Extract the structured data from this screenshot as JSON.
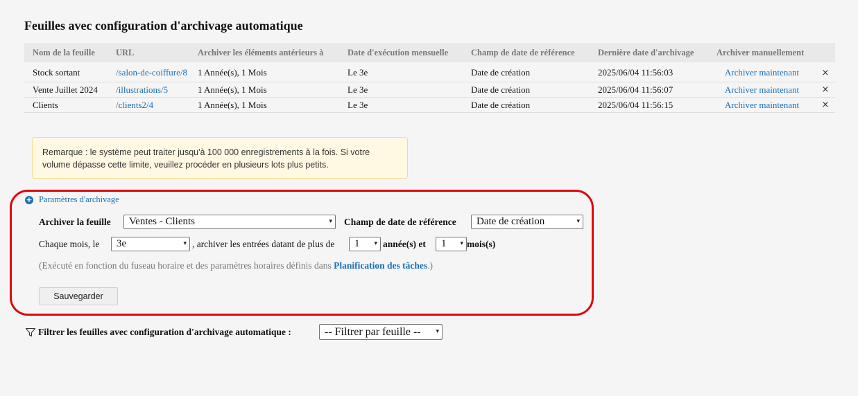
{
  "page": {
    "title": "Feuilles avec configuration d'archivage automatique"
  },
  "table": {
    "headers": [
      "Nom de la feuille",
      "URL",
      "Archiver les éléments antérieurs à",
      "Date d'exécution mensuelle",
      "Champ de date de référence",
      "Dernière date d'archivage",
      "Archiver manuellement"
    ],
    "rows": [
      {
        "name": "Stock sortant",
        "url": "/salon-de-coiffure/8",
        "archive_before": "1 Année(s), 1 Mois",
        "monthly_run": "Le 3e",
        "reference_field": "Date de création",
        "last_archive": "2025/06/04 11:56:03",
        "manual_action": "Archiver maintenant",
        "delete_icon": "×"
      },
      {
        "name": "Vente Juillet 2024",
        "url": "/illustrations/5",
        "archive_before": "1 Année(s), 1 Mois",
        "monthly_run": "Le 3e",
        "reference_field": "Date de création",
        "last_archive": "2025/06/04 11:56:07",
        "manual_action": "Archiver maintenant",
        "delete_icon": "×"
      },
      {
        "name": "Clients",
        "url": "/clients2/4",
        "archive_before": "1 Année(s), 1 Mois",
        "monthly_run": "Le 3e",
        "reference_field": "Date de création",
        "last_archive": "2025/06/04 11:56:15",
        "manual_action": "Archiver maintenant",
        "delete_icon": "×"
      }
    ]
  },
  "notice": {
    "text": "Remarque : le système peut traiter jusqu'à 100 000 enregistrements à la fois. Si votre volume dépasse cette limite, veuillez procéder en plusieurs lots plus petits."
  },
  "settings": {
    "toggle_label": "Paramètres d'archivage",
    "archive_sheet_label": "Archiver la feuille",
    "archive_sheet_value": "Ventes - Clients",
    "reference_field_label": "Champ de date de référence",
    "reference_field_value": "Date de création",
    "each_month_label": "Chaque mois, le",
    "day_value": "3e",
    "archive_entries_label": ", archiver les entrées datant de plus de",
    "years_value": "1",
    "years_label": "année(s) et",
    "months_value": "1",
    "months_label": "mois(s)",
    "hint_prefix": "(Exécuté en fonction du fuseau horaire et des paramètres horaires définis dans",
    "hint_link": "Planification des tâches",
    "hint_suffix": ".)",
    "save_label": "Sauvegarder"
  },
  "filter": {
    "label": "Filtrer les feuilles avec configuration d'archivage automatique :",
    "select_value": "-- Filtrer par feuille --"
  },
  "icons": {
    "chevron": "▾",
    "plus": "+",
    "filter": "filter-funnel-icon",
    "delete": "close-icon"
  },
  "colors": {
    "link": "#1a6fb3",
    "highlight_border": "#e3000f",
    "notice_bg": "#fff9e3"
  }
}
